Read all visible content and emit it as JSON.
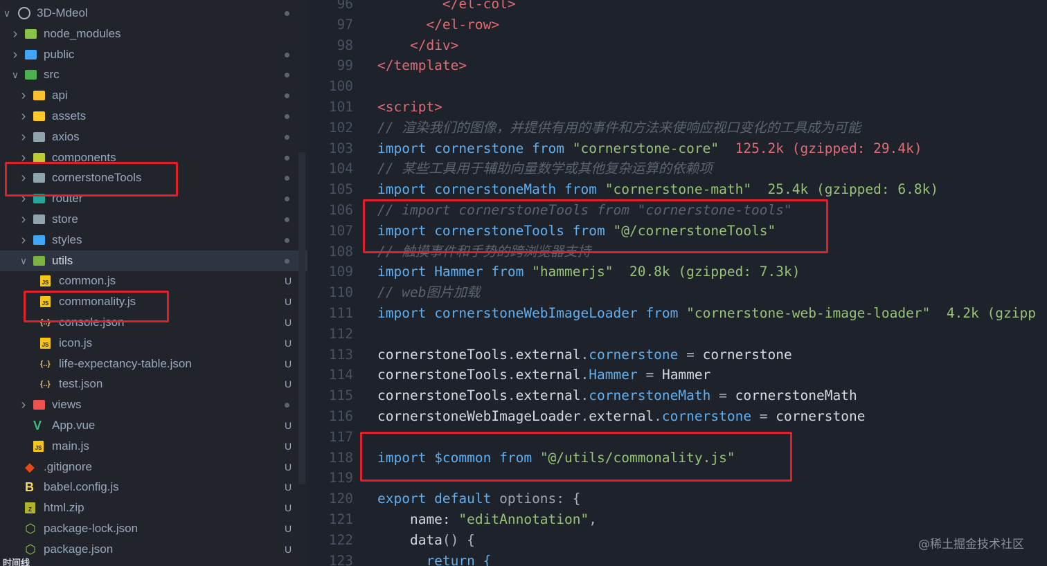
{
  "explorer": {
    "rows": [
      {
        "label": "3D-Mdeol",
        "depth": 0,
        "chevron": "down",
        "icon": "circle-outline-icon",
        "status": "dot"
      },
      {
        "label": "node_modules",
        "depth": 1,
        "chevron": "right",
        "icon": "folder-node-icon",
        "status": ""
      },
      {
        "label": "public",
        "depth": 1,
        "chevron": "right",
        "icon": "folder-public-icon",
        "status": "dot"
      },
      {
        "label": "src",
        "depth": 1,
        "chevron": "down",
        "icon": "folder-src-open-icon",
        "status": "dot"
      },
      {
        "label": "api",
        "depth": 2,
        "chevron": "right",
        "icon": "folder-api-icon",
        "status": "dot"
      },
      {
        "label": "assets",
        "depth": 2,
        "chevron": "right",
        "icon": "folder-assets-icon",
        "status": "dot"
      },
      {
        "label": "axios",
        "depth": 2,
        "chevron": "right",
        "icon": "folder-icon",
        "status": "dot"
      },
      {
        "label": "components",
        "depth": 2,
        "chevron": "right",
        "icon": "folder-components-icon",
        "status": "dot"
      },
      {
        "label": "cornerstoneTools",
        "depth": 2,
        "chevron": "right",
        "icon": "folder-icon",
        "status": "dot"
      },
      {
        "label": "router",
        "depth": 2,
        "chevron": "right",
        "icon": "folder-router-icon",
        "status": "dot"
      },
      {
        "label": "store",
        "depth": 2,
        "chevron": "right",
        "icon": "folder-icon",
        "status": "dot"
      },
      {
        "label": "styles",
        "depth": 2,
        "chevron": "right",
        "icon": "folder-styles-icon",
        "status": "dot"
      },
      {
        "label": "utils",
        "depth": 2,
        "chevron": "down",
        "icon": "folder-utils-open-icon",
        "status": "dot",
        "active": true
      },
      {
        "label": "common.js",
        "depth": 3,
        "chevron": "",
        "icon": "js-file-icon",
        "status": "U"
      },
      {
        "label": "commonality.js",
        "depth": 3,
        "chevron": "",
        "icon": "js-file-icon",
        "status": "U"
      },
      {
        "label": "console.json",
        "depth": 3,
        "chevron": "",
        "icon": "json-file-icon",
        "status": "U"
      },
      {
        "label": "icon.js",
        "depth": 3,
        "chevron": "",
        "icon": "js-file-icon",
        "status": "U"
      },
      {
        "label": "life-expectancy-table.json",
        "depth": 3,
        "chevron": "",
        "icon": "json-file-icon",
        "status": "U"
      },
      {
        "label": "test.json",
        "depth": 3,
        "chevron": "",
        "icon": "json-file-icon",
        "status": "U"
      },
      {
        "label": "views",
        "depth": 2,
        "chevron": "right",
        "icon": "folder-views-icon",
        "status": "dot"
      },
      {
        "label": "App.vue",
        "depth": 2,
        "chevron": "",
        "icon": "vue-file-icon",
        "status": "U"
      },
      {
        "label": "main.js",
        "depth": 2,
        "chevron": "",
        "icon": "js-file-icon",
        "status": "U"
      },
      {
        "label": ".gitignore",
        "depth": 1,
        "chevron": "",
        "icon": "git-file-icon",
        "status": "U"
      },
      {
        "label": "babel.config.js",
        "depth": 1,
        "chevron": "",
        "icon": "babel-file-icon",
        "status": "U"
      },
      {
        "label": "html.zip",
        "depth": 1,
        "chevron": "",
        "icon": "zip-file-icon",
        "status": "U"
      },
      {
        "label": "package-lock.json",
        "depth": 1,
        "chevron": "",
        "icon": "npm-json-icon",
        "status": "U"
      },
      {
        "label": "package.json",
        "depth": 1,
        "chevron": "",
        "icon": "npm-json-icon",
        "status": "U"
      }
    ],
    "footer_label": "时间线"
  },
  "editor": {
    "lines": [
      {
        "n": "96",
        "t": [
          [
            "        ",
            "id"
          ],
          [
            "</el-col>",
            "tag"
          ]
        ]
      },
      {
        "n": "97",
        "t": [
          [
            "      ",
            "id"
          ],
          [
            "</el-row>",
            "tag"
          ]
        ]
      },
      {
        "n": "98",
        "t": [
          [
            "    ",
            "id"
          ],
          [
            "</div>",
            "tag"
          ]
        ]
      },
      {
        "n": "99",
        "t": [
          [
            "</template>",
            "tag"
          ]
        ]
      },
      {
        "n": "100",
        "t": []
      },
      {
        "n": "101",
        "t": [
          [
            "<script>",
            "tag"
          ]
        ]
      },
      {
        "n": "102",
        "t": [
          [
            "// 渲染我们的图像，并提供有用的事件和方法来使响应视口变化的工具成为可能",
            "cm"
          ]
        ]
      },
      {
        "n": "103",
        "t": [
          [
            "import ",
            "kw"
          ],
          [
            "cornerstone ",
            "var"
          ],
          [
            "from ",
            "kw"
          ],
          [
            "\"cornerstone-core\"",
            "str"
          ],
          [
            "  125.2k (gzipped: 29.4k)",
            "size"
          ]
        ]
      },
      {
        "n": "104",
        "t": [
          [
            "// 某些工具用于辅助向量数学或其他复杂运算的依赖项",
            "cm"
          ]
        ]
      },
      {
        "n": "105",
        "t": [
          [
            "import ",
            "kw"
          ],
          [
            "cornerstoneMath ",
            "var"
          ],
          [
            "from ",
            "kw"
          ],
          [
            "\"cornerstone-math\"",
            "str"
          ],
          [
            "  25.4k (gzipped: 6.8k)",
            "size2"
          ]
        ]
      },
      {
        "n": "106",
        "t": [
          [
            "// import cornerstoneTools from \"cornerstone-tools\"",
            "cm"
          ]
        ]
      },
      {
        "n": "107",
        "t": [
          [
            "import ",
            "kw"
          ],
          [
            "cornerstoneTools ",
            "var"
          ],
          [
            "from ",
            "kw"
          ],
          [
            "\"@/cornerstoneTools\"",
            "str"
          ]
        ]
      },
      {
        "n": "108",
        "t": [
          [
            "// 触摸事件和手势的跨浏览器支持",
            "cm"
          ]
        ]
      },
      {
        "n": "109",
        "t": [
          [
            "import ",
            "kw"
          ],
          [
            "Hammer ",
            "var"
          ],
          [
            "from ",
            "kw"
          ],
          [
            "\"hammerjs\"",
            "str"
          ],
          [
            "  20.8k (gzipped: 7.3k)",
            "size2"
          ]
        ]
      },
      {
        "n": "110",
        "t": [
          [
            "// web图片加载",
            "cm"
          ]
        ]
      },
      {
        "n": "111",
        "t": [
          [
            "import ",
            "kw"
          ],
          [
            "cornerstoneWebImageLoader ",
            "var"
          ],
          [
            "from ",
            "kw"
          ],
          [
            "\"cornerstone-web-image-loader\"",
            "str"
          ],
          [
            "  4.2k (gzipp",
            "size2"
          ]
        ]
      },
      {
        "n": "112",
        "t": []
      },
      {
        "n": "113",
        "t": [
          [
            "cornerstoneTools",
            "id"
          ],
          [
            ".",
            "br"
          ],
          [
            "external",
            "id"
          ],
          [
            ".",
            "br"
          ],
          [
            "cornerstone",
            "prop"
          ],
          [
            " = ",
            "br"
          ],
          [
            "cornerstone",
            "id"
          ]
        ]
      },
      {
        "n": "114",
        "t": [
          [
            "cornerstoneTools",
            "id"
          ],
          [
            ".",
            "br"
          ],
          [
            "external",
            "id"
          ],
          [
            ".",
            "br"
          ],
          [
            "Hammer",
            "prop"
          ],
          [
            " = ",
            "br"
          ],
          [
            "Hammer",
            "id"
          ]
        ]
      },
      {
        "n": "115",
        "t": [
          [
            "cornerstoneTools",
            "id"
          ],
          [
            ".",
            "br"
          ],
          [
            "external",
            "id"
          ],
          [
            ".",
            "br"
          ],
          [
            "cornerstoneMath",
            "prop"
          ],
          [
            " = ",
            "br"
          ],
          [
            "cornerstoneMath",
            "id"
          ]
        ]
      },
      {
        "n": "116",
        "t": [
          [
            "cornerstoneWebImageLoader",
            "id"
          ],
          [
            ".",
            "br"
          ],
          [
            "external",
            "id"
          ],
          [
            ".",
            "br"
          ],
          [
            "cornerstone",
            "prop"
          ],
          [
            " = ",
            "br"
          ],
          [
            "cornerstone",
            "id"
          ]
        ]
      },
      {
        "n": "117",
        "t": []
      },
      {
        "n": "118",
        "t": [
          [
            "import ",
            "kw"
          ],
          [
            "$common ",
            "var"
          ],
          [
            "from ",
            "kw"
          ],
          [
            "\"@/utils/commonality.js\"",
            "str"
          ]
        ]
      },
      {
        "n": "119",
        "t": []
      },
      {
        "n": "120",
        "t": [
          [
            "export default ",
            "kw"
          ],
          [
            "options:",
            "opt"
          ],
          [
            " {",
            "br"
          ]
        ]
      },
      {
        "n": "121",
        "t": [
          [
            "    name: ",
            "id"
          ],
          [
            "\"editAnnotation\"",
            "str"
          ],
          [
            ",",
            "br"
          ]
        ]
      },
      {
        "n": "122",
        "t": [
          [
            "    data",
            "id"
          ],
          [
            "() {",
            "br"
          ]
        ]
      },
      {
        "n": "123",
        "t": [
          [
            "      return {",
            "kw"
          ]
        ]
      }
    ]
  },
  "watermark": "@稀土掘金技术社区",
  "colors": {
    "highlight_border": "#e0202a",
    "editor_bg": "#1e222a",
    "sidebar_bg": "#21252b"
  }
}
